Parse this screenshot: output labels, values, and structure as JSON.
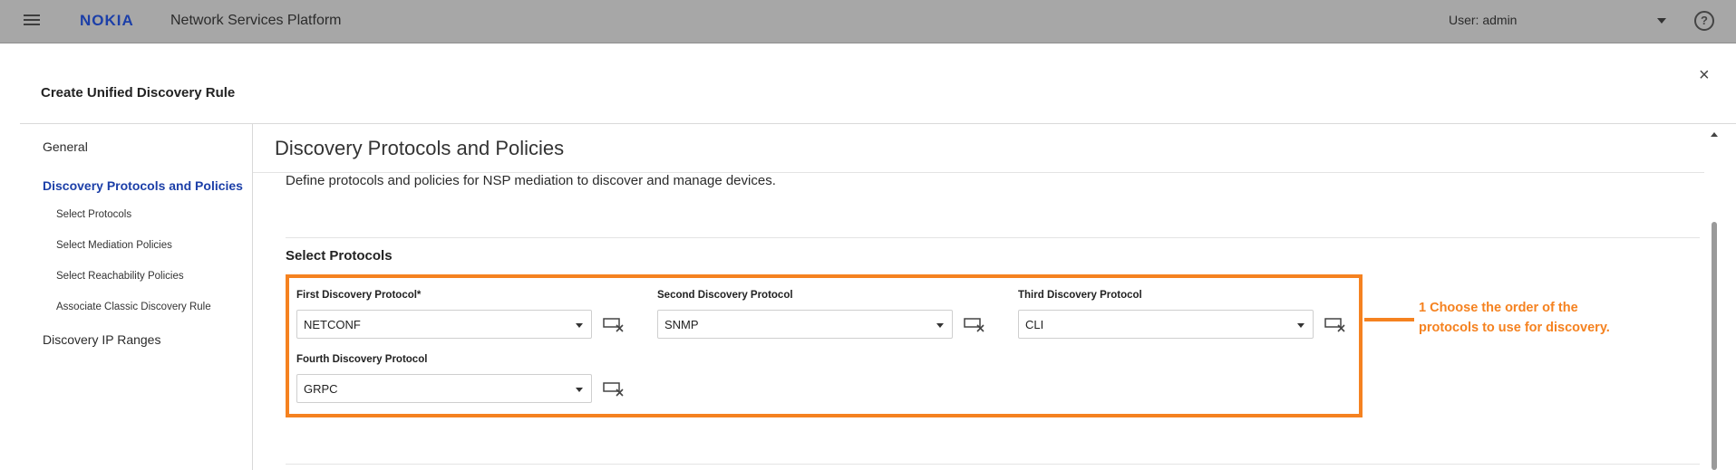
{
  "topbar": {
    "logo": "NOKIA",
    "app_title": "Network Services Platform",
    "user_label": "User: admin",
    "help_label": "?"
  },
  "dialog": {
    "title": "Create Unified Discovery Rule",
    "close_label": "×"
  },
  "nav": {
    "general": "General",
    "discovery_protocols": "Discovery Protocols and Policies",
    "sub_items": [
      "Select Protocols",
      "Select Mediation Policies",
      "Select Reachability Policies",
      "Associate Classic Discovery Rule"
    ],
    "ip_ranges": "Discovery IP Ranges"
  },
  "main": {
    "section_title": "Discovery Protocols and Policies",
    "description": "Define protocols and policies for NSP mediation to discover and manage devices.",
    "subsection_title": "Select Protocols",
    "fields": [
      {
        "label": "First Discovery Protocol*",
        "value": "NETCONF"
      },
      {
        "label": "Second Discovery Protocol",
        "value": "SNMP"
      },
      {
        "label": "Third Discovery Protocol",
        "value": "CLI"
      },
      {
        "label": "Fourth Discovery Protocol",
        "value": "GRPC"
      }
    ]
  },
  "callout": {
    "line1": "1  Choose the order of the",
    "line2": "protocols to use for discovery."
  },
  "colors": {
    "topbar": "#a7a7a7",
    "brand": "#1c3fa8",
    "callout": "#f58220"
  },
  "icons": {
    "menu": "hamburger-icon",
    "help": "help-circle-icon",
    "close": "close-icon",
    "clear": "clear-field-icon",
    "dropdown": "chevron-down-icon"
  }
}
